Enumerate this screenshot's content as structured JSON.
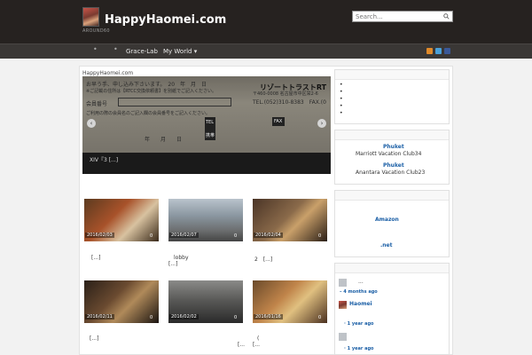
{
  "header": {
    "site_title": "HappyHaomei.com",
    "tagline": "AROUND60",
    "search_placeholder": "Search..."
  },
  "nav": {
    "items": [
      {
        "label": "Grace-Lab"
      },
      {
        "label": "My World ▾"
      }
    ]
  },
  "breadcrumb": "HappyHaomei.com",
  "slider": {
    "caption": "XIV『3 [...]",
    "paper": {
      "line1": "お早う手、申し込み下さいます。　20　年　月　日",
      "line2": "※ご記載の住所は【RTCC交換依頼書】を別紙でご記入ください。",
      "line3": "会員番号",
      "line4": "ご利用の際の会員名のご記入欄の会員番号をご記入ください。",
      "header_right": "リゾートトラストRT",
      "addr": "〒460-0008 名古屋市中区栄2-6",
      "tel": "TEL.(052)310-8383　FAX.(0",
      "label_tel": "TEL",
      "label_fax": "FAX",
      "label_mobile": "携帯",
      "date_row": "年　　月　　日"
    }
  },
  "posts": [
    {
      "date": "2016/02/03",
      "comments": "0",
      "excerpt": "[...]"
    },
    {
      "date": "2016/02/07",
      "comments": "0",
      "excerpt": "lobby",
      "excerpt2": "[...]"
    },
    {
      "date": "2016/02/04",
      "comments": "0",
      "excerpt": "2　[...]"
    },
    {
      "date": "2016/02/11",
      "comments": "0",
      "excerpt": "[...]"
    },
    {
      "date": "2016/02/02",
      "comments": "0",
      "excerpt": "[..."
    },
    {
      "date": "2016/01/16",
      "comments": "0",
      "excerpt": "(",
      "excerpt2": "[..."
    }
  ],
  "sidebar": {
    "widget1_bullets": [
      "•",
      "•",
      "•",
      "•",
      "•"
    ],
    "phuket1_title": "Phuket",
    "phuket1_text": "Marriott Vacation Club34",
    "phuket2_title": "Phuket",
    "phuket2_text": "Anantara Vacation Club23",
    "amazon_link": "Amazon",
    "net_link": ".net",
    "comments": [
      {
        "name": "...",
        "ago": "– 4 months ago"
      },
      {
        "name": "Haomei",
        "ago": ""
      },
      {
        "name": "",
        "ago": "· 1 year ago"
      },
      {
        "name": "",
        "ago": "· 1 year ago"
      }
    ]
  },
  "colors": {
    "header_bg": "#262220",
    "nav_bg": "#3a3735",
    "link_blue": "#1b5fa6"
  }
}
